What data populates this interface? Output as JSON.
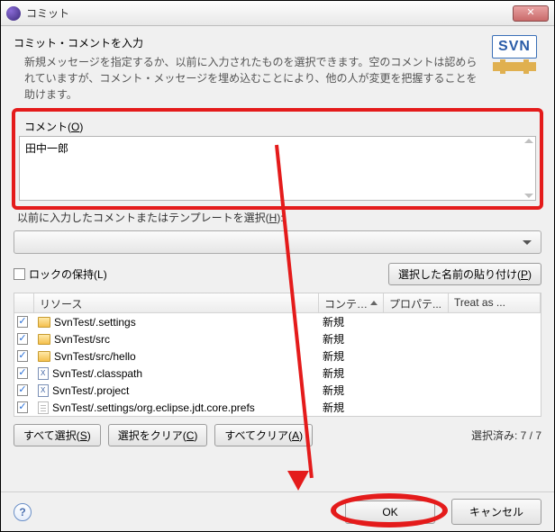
{
  "window": {
    "title": "コミット"
  },
  "header": {
    "heading": "コミット・コメントを入力",
    "desc": "新規メッセージを指定するか、以前に入力されたものを選択できます。空のコメントは認められていますが、コメント・メッセージを埋め込むことにより、他の人が変更を把握することを助けます。",
    "logo": "SVN"
  },
  "comment": {
    "group_label_pre": "コメント(",
    "group_label_key": "O",
    "group_label_post": ")",
    "value": "田中一郎"
  },
  "hidden_label": {
    "pre": "以前に入力したコメントまたはテンプレートを選択(",
    "key": "H",
    "post": "):"
  },
  "lock": {
    "pre": "ロックの保持(",
    "key": "L",
    "post": ")"
  },
  "paste_btn": {
    "pre": "選択した名前の貼り付け(",
    "key": "P",
    "post": ")"
  },
  "table": {
    "cols": {
      "resource": "リソース",
      "content": "コンテンツ",
      "props": "プロパテ...",
      "treat": "Treat as ..."
    },
    "rows": [
      {
        "checked": true,
        "icon": "folder",
        "name": "SvnTest/.settings",
        "content": "新規"
      },
      {
        "checked": true,
        "icon": "folder",
        "name": "SvnTest/src",
        "content": "新規"
      },
      {
        "checked": true,
        "icon": "folder",
        "name": "SvnTest/src/hello",
        "content": "新規"
      },
      {
        "checked": true,
        "icon": "xml",
        "name": "SvnTest/.classpath",
        "content": "新規"
      },
      {
        "checked": true,
        "icon": "xml",
        "name": "SvnTest/.project",
        "content": "新規"
      },
      {
        "checked": true,
        "icon": "file",
        "name": "SvnTest/.settings/org.eclipse.jdt.core.prefs",
        "content": "新規"
      }
    ]
  },
  "btns": {
    "select_all": {
      "pre": "すべて選択(",
      "key": "S",
      "post": ")"
    },
    "clear_sel": {
      "pre": "選択をクリア(",
      "key": "C",
      "post": ")"
    },
    "clear_all": {
      "pre": "すべてクリア(",
      "key": "A",
      "post": ")"
    }
  },
  "status": "選択済み: 7 / 7",
  "footer": {
    "ok": "OK",
    "cancel": "キャンセル",
    "help": "?"
  }
}
